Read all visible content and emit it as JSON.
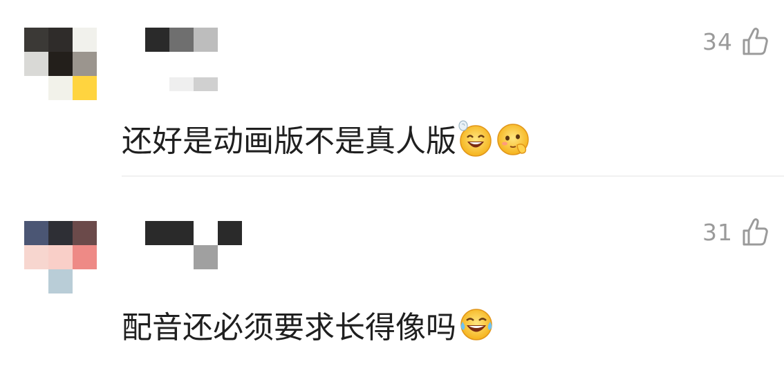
{
  "comments": [
    {
      "likes": "34",
      "text": "还好是动画版不是真人版",
      "emojis": [
        "grin-sweat-emoji",
        "shy-peek-emoji"
      ]
    },
    {
      "likes": "31",
      "text": "配音还必须要求长得像吗",
      "emojis": [
        "laugh-cry-emoji"
      ]
    }
  ],
  "icons": {
    "like": "thumbs-up-icon"
  },
  "colors": {
    "text": "#1f1f1f",
    "muted": "#9a9a9a",
    "divider": "#f1f1f1"
  }
}
